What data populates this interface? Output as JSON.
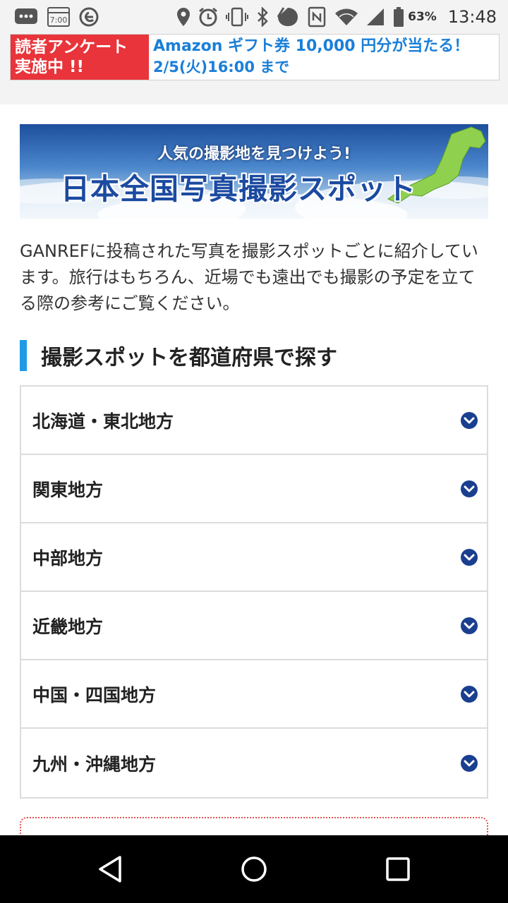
{
  "status_bar": {
    "battery_percent": "63%",
    "time": "13:48",
    "icons": [
      "chat-bubble-icon",
      "calendar-icon",
      "ecosia-icon",
      "location-pin-icon",
      "alarm-icon",
      "vibrate-icon",
      "bluetooth-icon",
      "data-saver-icon",
      "nfc-icon",
      "wifi-icon",
      "signal-icon",
      "battery-icon"
    ]
  },
  "promo_banner": {
    "left_line1": "読者アンケート",
    "left_line2": "実施中 !!",
    "right_line1": "Amazon ギフト券 10,000 円分が当たる！",
    "right_line2": "2/5(火)16:00 まで",
    "colors": {
      "left_bg": "#e8343a",
      "right_text": "#1a7fd8"
    }
  },
  "hero": {
    "subtitle": "人気の撮影地を見つけよう!",
    "title": "日本全国写真撮影スポット"
  },
  "intro": {
    "text": "GANREFに投稿された写真を撮影スポットごとに紹介しています。旅行はもちろん、近場でも遠出でも撮影の予定を立てる際の参考にご覧ください。"
  },
  "section": {
    "title": "撮影スポットを都道府県で探す",
    "accent_color": "#1e9ae6"
  },
  "regions": [
    {
      "label": "北海道・東北地方"
    },
    {
      "label": "関東地方"
    },
    {
      "label": "中部地方"
    },
    {
      "label": "近畿地方"
    },
    {
      "label": "中国・四国地方"
    },
    {
      "label": "九州・沖縄地方"
    }
  ],
  "nav_bar": {
    "icons": [
      "back-icon",
      "home-icon",
      "recent-apps-icon"
    ]
  }
}
